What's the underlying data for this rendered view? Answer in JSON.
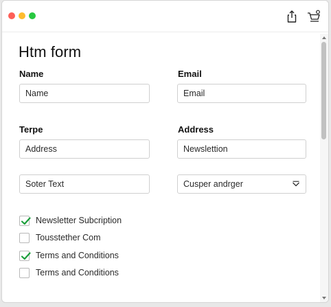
{
  "window": {
    "controls": [
      "close",
      "minimize",
      "zoom"
    ],
    "toolbar_icons": [
      "share-icon",
      "cart-icon"
    ]
  },
  "form": {
    "title": "Htm form",
    "name_label": "Name",
    "name_value": "Name",
    "email_label": "Email",
    "email_value": "Email",
    "terpe_label": "Terpe",
    "terpe_value": "Address",
    "address_label": "Address",
    "address_value": "Newslettion",
    "other_value": "Soter Text",
    "select_value": "Cusper andrger",
    "checkboxes": [
      {
        "label": "Newsletter Subcription",
        "checked": true
      },
      {
        "label": "Tousstether Com",
        "checked": false
      },
      {
        "label": "Terms and Conditions",
        "checked": true
      },
      {
        "label": "Terms and Conditions",
        "checked": false
      }
    ]
  },
  "colors": {
    "check": "#1a9e3a",
    "close": "#fe5f57",
    "minimize": "#febc2e",
    "zoom": "#28c840"
  }
}
